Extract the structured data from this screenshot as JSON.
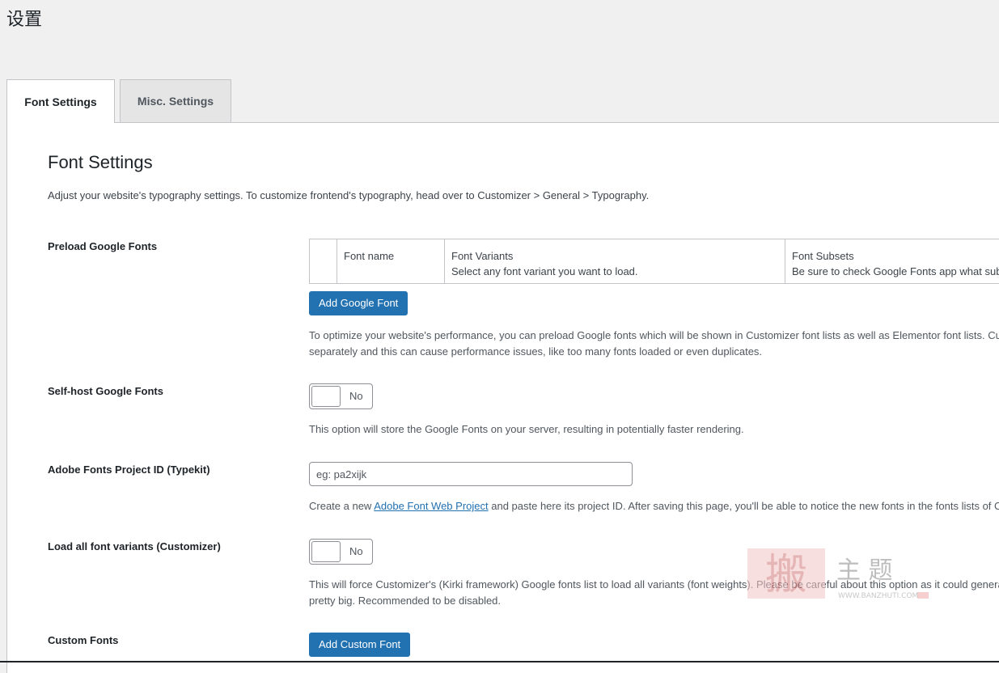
{
  "page": {
    "title": "设置"
  },
  "tabs": [
    {
      "label": "Font Settings",
      "active": true
    },
    {
      "label": "Misc. Settings",
      "active": false
    }
  ],
  "section": {
    "title": "Font Settings",
    "description": "Adjust your website's typography settings. To customize frontend's typography, head over to Customizer > General > Typography."
  },
  "preload": {
    "label": "Preload Google Fonts",
    "table": {
      "font_name_header": "Font name",
      "variants_header": "Font Variants",
      "variants_sub": "Select any font variant you want to load.",
      "subsets_header": "Font Subsets",
      "subsets_sub": "Be sure to check Google Fonts app what subs"
    },
    "add_button": "Add Google Font",
    "desc_line1": "To optimize your website's performance, you can preload Google fonts which will be shown in Customizer font lists as well as Elementor font lists. Cur",
    "desc_line2": "separately and this can cause performance issues, like too many fonts loaded or even duplicates."
  },
  "selfhost": {
    "label": "Self-host Google Fonts",
    "toggle_text": "No",
    "desc": "This option will store the Google Fonts on your server, resulting in potentially faster rendering."
  },
  "adobe": {
    "label": "Adobe Fonts Project ID (Typekit)",
    "placeholder": "eg: pa2xijk",
    "desc_pre": "Create a new ",
    "desc_link": "Adobe Font Web Project",
    "desc_post": " and paste here its project ID. After saving this page, you'll be able to notice the new fonts in the fonts lists of C"
  },
  "variants": {
    "label": "Load all font variants (Customizer)",
    "toggle_text": "No",
    "desc_line1": "This will force Customizer's (Kirki framework) Google fonts list to load all variants (font weights). Please be careful about this option as it could genera",
    "desc_line2": "pretty big. Recommended to be disabled."
  },
  "custom": {
    "label": "Custom Fonts",
    "add_button": "Add Custom Font"
  },
  "watermark": {
    "text": "主 题",
    "url_text": "WWW.BANZHUTI.COM"
  }
}
